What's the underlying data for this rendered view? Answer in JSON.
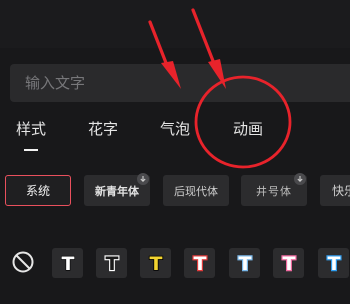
{
  "search": {
    "placeholder": "输入文字"
  },
  "tabs": [
    {
      "label": "样式",
      "active": true
    },
    {
      "label": "花字",
      "active": false
    },
    {
      "label": "气泡",
      "active": false
    },
    {
      "label": "动画",
      "active": false
    }
  ],
  "fonts": [
    {
      "label": "系统",
      "selected": true,
      "download": false
    },
    {
      "label": "新青年体",
      "selected": false,
      "download": true
    },
    {
      "label": "后现代体",
      "selected": false,
      "download": false
    },
    {
      "label": "井号体",
      "selected": false,
      "download": true
    },
    {
      "label": "快乐",
      "selected": false,
      "download": false
    }
  ],
  "style_presets": [
    {
      "glyph": "T",
      "fill": "#ffffff",
      "stroke": "#000000"
    },
    {
      "glyph": "T",
      "fill": "#000000",
      "stroke": "#ffffff"
    },
    {
      "glyph": "T",
      "fill": "#f3d430",
      "stroke": "#000000"
    },
    {
      "glyph": "T",
      "fill": "#ffffff",
      "stroke": "#e23b3b"
    },
    {
      "glyph": "T",
      "fill": "#ffffff",
      "stroke": "#7ab8ea"
    },
    {
      "glyph": "T",
      "fill": "#ffffff",
      "stroke": "#f06aa0"
    },
    {
      "glyph": "T",
      "fill": "#ffffff",
      "stroke": "#2f9ef0"
    }
  ],
  "colors": {
    "background": "#18181a",
    "accent_selected": "#e9505d",
    "annotation_red": "#e8232b"
  }
}
